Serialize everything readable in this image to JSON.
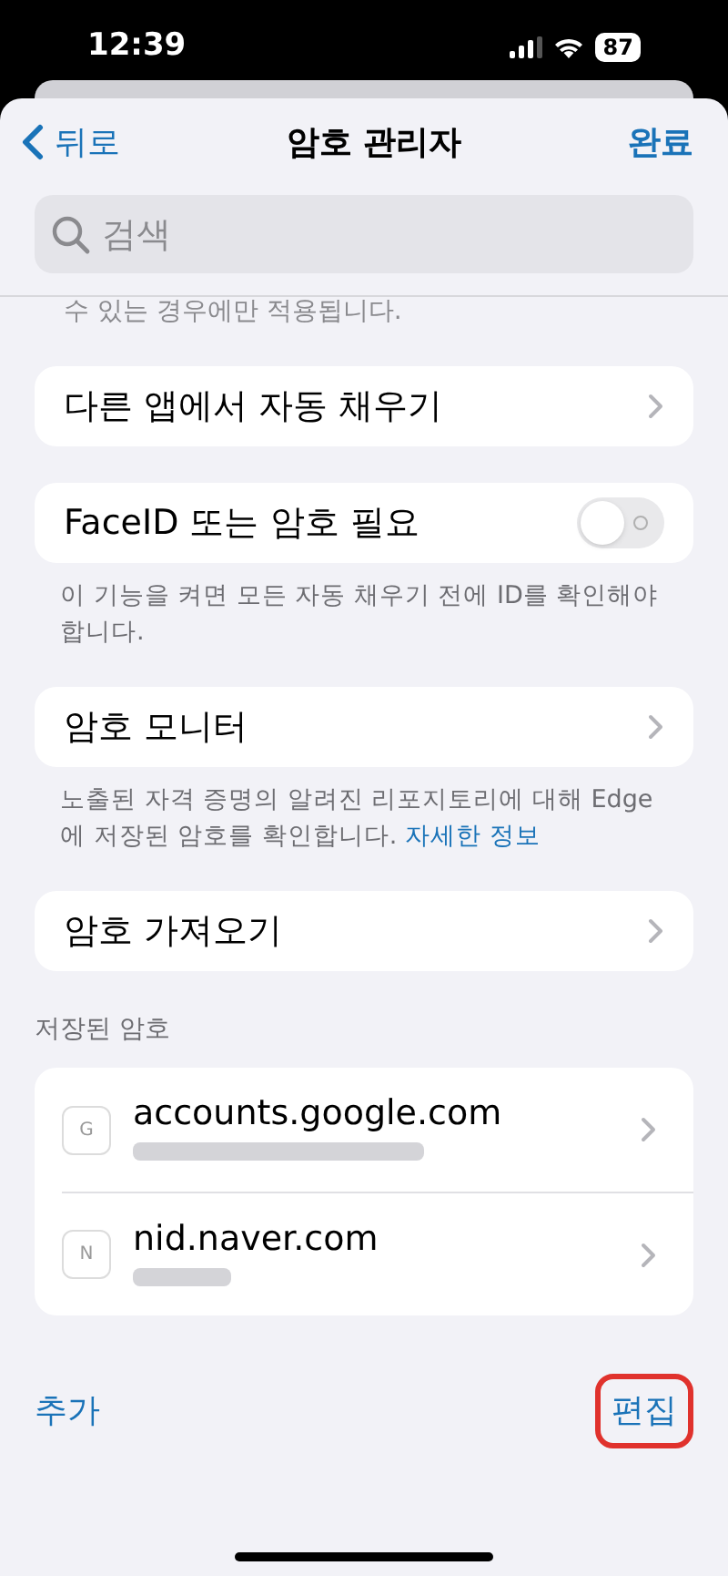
{
  "status_bar": {
    "time": "12:39",
    "battery": "87"
  },
  "nav": {
    "back": "뒤로",
    "title": "암호 관리자",
    "done": "완료"
  },
  "search": {
    "placeholder": "검색"
  },
  "top_caption": "수 있는 경우에만 적용됩니다.",
  "settings": [
    {
      "kind": "link",
      "label": "다른 앱에서 자동 채우기"
    },
    {
      "kind": "toggle",
      "label": "FaceID 또는 암호 필요",
      "on": false,
      "caption": "이 기능을 켜면 모든 자동 채우기 전에 ID를 확인해야 합니다."
    },
    {
      "kind": "link",
      "label": "암호 모니터",
      "caption": "노출된 자격 증명의 알려진 리포지토리에 대해 Edge에 저장된 암호를 확인합니다.",
      "caption_link": "자세한 정보"
    },
    {
      "kind": "link",
      "label": "암호 가져오기"
    }
  ],
  "saved_header": "저장된 암호",
  "saved": [
    {
      "letter": "G",
      "site": "accounts.google.com",
      "username_redacted": true
    },
    {
      "letter": "N",
      "site": "nid.naver.com",
      "username_redacted": true
    }
  ],
  "footer": {
    "add": "추가",
    "edit": "편집",
    "edit_highlighted": true
  }
}
